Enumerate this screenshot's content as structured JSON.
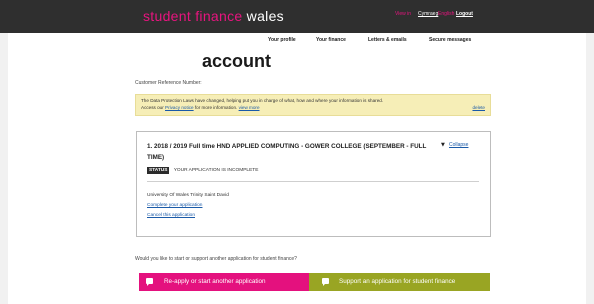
{
  "header": {
    "brand_part1": "student finance",
    "brand_part2": "wales",
    "lang_label": "View in",
    "lang_cymraeg": "Cymraeg",
    "lang_sep": "|",
    "lang_english": "English",
    "logout": "Logout"
  },
  "nav": {
    "items": [
      "Your profile",
      "Your finance",
      "Letters & emails",
      "Secure messages"
    ]
  },
  "page": {
    "title": "account",
    "crn_label": "Customer Reference Number:"
  },
  "notice": {
    "line1": "The Data Protection Laws have changed, helping put you in charge of what, how and where your information is shared.",
    "line2_prefix": "Access our",
    "privacy_link": "Privacy notice",
    "line2_mid": "for more information.",
    "view_more": "view more",
    "delete": "delete"
  },
  "application": {
    "title": "1. 2018 / 2019 Full time HND APPLIED COMPUTING - GOWER COLLEGE (SEPTEMBER - FULL TIME)",
    "collapse": "Collapse",
    "status_badge": "STATUS",
    "status_text": "YOUR APPLICATION IS INCOMPLETE",
    "institution": "University Of Wales Trinity Saint David",
    "complete_link": "Complete your application",
    "cancel_link": "Cancel this application"
  },
  "actions": {
    "question": "Would you like to start or support another application for student finance?",
    "reapply": "Re-apply or start another application",
    "support": "Support an application for student finance"
  },
  "colors": {
    "brand_pink": "#e4117e",
    "brand_green": "#99a523",
    "topbar": "#2f2f2f",
    "notice_bg": "#f6eeb7"
  }
}
